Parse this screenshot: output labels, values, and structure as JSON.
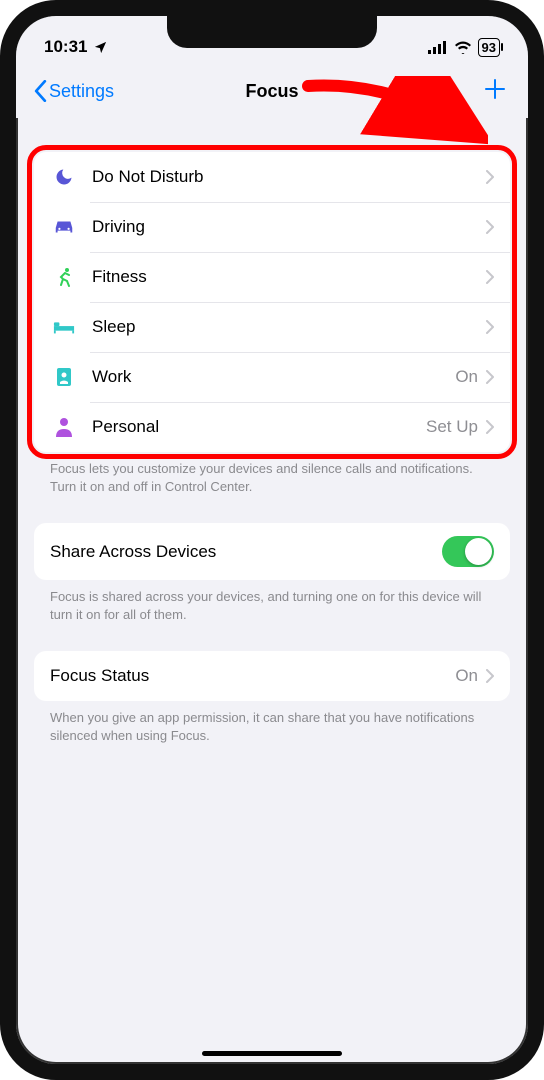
{
  "status": {
    "time": "10:31",
    "battery": "93"
  },
  "nav": {
    "back": "Settings",
    "title": "Focus"
  },
  "focus_list": [
    {
      "icon": "moon",
      "color": "#5856d6",
      "label": "Do Not Disturb",
      "detail": ""
    },
    {
      "icon": "car",
      "color": "#5856d6",
      "label": "Driving",
      "detail": ""
    },
    {
      "icon": "runner",
      "color": "#30d158",
      "label": "Fitness",
      "detail": ""
    },
    {
      "icon": "bed",
      "color": "#30c8c8",
      "label": "Sleep",
      "detail": ""
    },
    {
      "icon": "badge",
      "color": "#30c8c8",
      "label": "Work",
      "detail": "On"
    },
    {
      "icon": "person",
      "color": "#af52de",
      "label": "Personal",
      "detail": "Set Up"
    }
  ],
  "footer1": "Focus lets you customize your devices and silence calls and notifications. Turn it on and off in Control Center.",
  "share": {
    "label": "Share Across Devices",
    "on": true
  },
  "footer2": "Focus is shared across your devices, and turning one on for this device will turn it on for all of them.",
  "status_row": {
    "label": "Focus Status",
    "detail": "On"
  },
  "footer3": "When you give an app permission, it can share that you have notifications silenced when using Focus."
}
